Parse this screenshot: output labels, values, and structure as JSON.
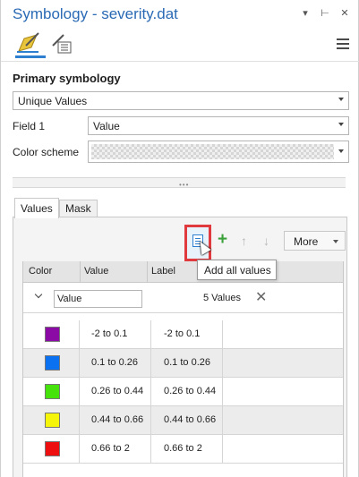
{
  "title": "Symbology - severity.dat",
  "titlebar_icons": {
    "dropdown": "▾",
    "pin": "⊢",
    "close": "✕"
  },
  "icons": {
    "primary_symbology_tab": "paint-brush-icon",
    "vary_symbology_tab": "brush-list-icon",
    "menu": "hamburger-menu-icon"
  },
  "primary_symbology": {
    "heading": "Primary symbology",
    "renderer": "Unique Values"
  },
  "field1": {
    "label": "Field 1",
    "value": "Value"
  },
  "color_scheme": {
    "label": "Color scheme"
  },
  "values_panel": {
    "tabs": [
      "Values",
      "Mask"
    ],
    "toolbar": {
      "add_all_tooltip": "Add all values",
      "plus": "+",
      "up": "↑",
      "down": "↓",
      "more": "More"
    },
    "columns": [
      "Color",
      "Value",
      "Label"
    ],
    "group": {
      "name": "Value",
      "count": "5 Values",
      "remove": "✕"
    },
    "rows": [
      {
        "color": "#8b0aa5",
        "value": "-2 to 0.1",
        "label": "-2 to 0.1"
      },
      {
        "color": "#0a72f0",
        "value": "0.1 to 0.26",
        "label": "0.1 to 0.26"
      },
      {
        "color": "#46e20c",
        "value": "0.26 to 0.44",
        "label": "0.26 to 0.44"
      },
      {
        "color": "#f5f50a",
        "value": "0.44 to 0.66",
        "label": "0.44 to 0.66"
      },
      {
        "color": "#ee1010",
        "value": "0.66 to 2",
        "label": "0.66 to 2"
      }
    ]
  }
}
